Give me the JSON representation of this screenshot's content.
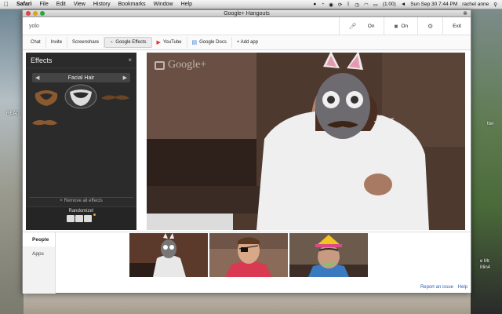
{
  "menubar": {
    "apple": "",
    "items": [
      "Safari",
      "File",
      "Edit",
      "View",
      "History",
      "Bookmarks",
      "Window",
      "Help"
    ],
    "battery": "(1:00)",
    "clock": "Sun Sep 30  7:44 PM",
    "user": "rachel anne"
  },
  "window": {
    "title": "Google+ Hangouts",
    "close": "⊗"
  },
  "header": {
    "topic": "yolo",
    "mic_label": "On",
    "cam_label": "On",
    "exit_label": "Exit"
  },
  "toolbar": {
    "items": [
      {
        "label": "Chat"
      },
      {
        "label": "Invite"
      },
      {
        "label": "Screenshare"
      },
      {
        "label": "Google Effects",
        "active": true
      },
      {
        "label": "YouTube"
      },
      {
        "label": "Google Docs"
      },
      {
        "label": "+ Add app"
      }
    ]
  },
  "effects": {
    "title": "Effects",
    "close": "×",
    "category": "Facial Hair",
    "remove_all": "× Remove all effects",
    "randomize": "Randomize!"
  },
  "video": {
    "logo_text": "Google+"
  },
  "sidebar_tabs": [
    {
      "label": "People",
      "active": true
    },
    {
      "label": "Apps",
      "active": false
    }
  ],
  "footer": {
    "report": "Report an issue",
    "help": "Help"
  },
  "desktop": {
    "ready_label": "READ",
    "right_label": "tter",
    "right_label2": "e Mr.",
    "right_label3": "Min4"
  },
  "colors": {
    "effects_bg": "#2b2b2b",
    "link": "#2a5db0"
  }
}
